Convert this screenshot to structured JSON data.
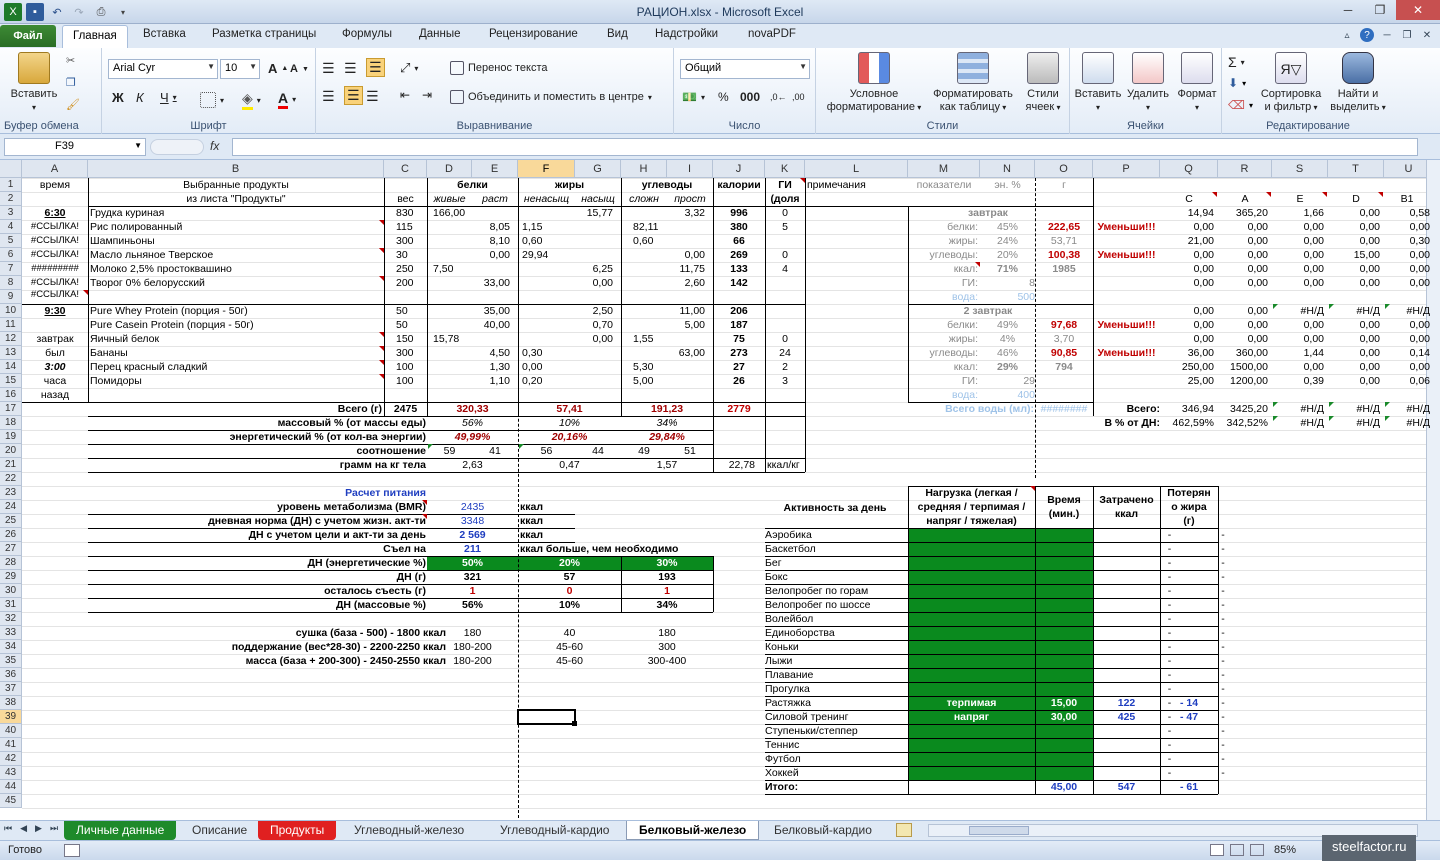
{
  "title": "РАЦИОН.xlsx - Microsoft Excel",
  "ribbon_tabs": [
    "Файл",
    "Главная",
    "Вставка",
    "Разметка страницы",
    "Формулы",
    "Данные",
    "Рецензирование",
    "Вид",
    "Надстройки",
    "novaPDF"
  ],
  "ribbon": {
    "paste": "Вставить",
    "clipboard": "Буфер обмена",
    "font_name": "Arial Cyr",
    "font_size": "10",
    "font_group": "Шрифт",
    "wrap": "Перенос текста",
    "merge": "Объединить и поместить в центре",
    "align_group": "Выравнивание",
    "num_format": "Общий",
    "number_group": "Число",
    "cond1": "Условное",
    "cond2": "форматирование",
    "fmt1": "Форматировать",
    "fmt2": "как таблицу",
    "sty1": "Стили",
    "sty2": "ячеек",
    "styles_group": "Стили",
    "ins": "Вставить",
    "del": "Удалить",
    "fmt": "Формат",
    "cells_group": "Ячейки",
    "sort1": "Сортировка",
    "sort2": "и фильтр",
    "find1": "Найти и",
    "find2": "выделить",
    "edit_group": "Редактирование"
  },
  "namebox": "F39",
  "fx": "fx",
  "columns": [
    "A",
    "B",
    "C",
    "D",
    "E",
    "F",
    "G",
    "H",
    "I",
    "J",
    "K",
    "L",
    "M",
    "N",
    "O",
    "P",
    "Q",
    "R",
    "S",
    "T",
    "U"
  ],
  "rows": [
    "1",
    "2",
    "3",
    "4",
    "5",
    "6",
    "7",
    "8",
    "9",
    "10",
    "11",
    "12",
    "13",
    "14",
    "15",
    "16",
    "17",
    "18",
    "19",
    "20",
    "21",
    "22",
    "23",
    "24",
    "25",
    "26",
    "27",
    "28",
    "29",
    "30",
    "31",
    "32",
    "33",
    "34",
    "35",
    "36",
    "37",
    "38",
    "39",
    "40",
    "41",
    "42",
    "43",
    "44",
    "45"
  ],
  "sheet_tabs": [
    "Личные данные",
    "Описание",
    "Продукты",
    "Углеводный-железо",
    "Углеводный-кардио",
    "Белковый-железо",
    "Белковый-кардио"
  ],
  "status": {
    "ready": "Готово",
    "zoom": "85%",
    "watermark": "steelfactor.ru"
  },
  "cells": {
    "h_time": "время",
    "h_prod1": "Выбранные продукты",
    "h_prod2": "из листа \"Продукты\"",
    "h_ves": "вес",
    "h_belki": "белки",
    "h_zhiry": "жиры",
    "h_ugl": "углеводы",
    "h_kal": "калории",
    "h_gi": "ГИ",
    "h_gi2": "(доля",
    "h_prim": "примечания",
    "h_pok": "показатели",
    "h_en": "эн. %",
    "h_g": "г",
    "h_zhiv": "живые",
    "h_rast": "раст",
    "h_nenas": "ненасыщ",
    "h_nas": "насыщ",
    "h_slozh": "сложн",
    "h_prost": "прост",
    "t630": "6:30",
    "t930": "9:30",
    "ref": "#ССЫЛКА!",
    "hash": "#########",
    "zav": "завтрак",
    "byl": "был",
    "t300": "3:00",
    "chasa": "часа",
    "nazad": "назад",
    "p1": "Грудка куриная",
    "p2": "Рис полированный",
    "p3": "Шампиньоны",
    "p4": "Масло льняное Тверское",
    "p5": "Молоко 2,5% простоквашино",
    "p6": "Творог 0% белорусский",
    "p7": "Pure Whey Protein (порция - 50г)",
    "p8": "Pure Casein Protein (порция - 50г)",
    "p9": "Яичный белок",
    "p10": "Бананы",
    "p11": "Перец красный сладкий",
    "p12": "Помидоры",
    "total": "Всего (г)",
    "mass": "массовый % (от массы еды)",
    "energy": "энергетический % (от кол-ва энергии)",
    "ratio": "соотношение",
    "gkg": "грамм на кг тела",
    "kkalkg": "ккал/кг",
    "calc": "Расчет питания",
    "bmr": "уровень метаболизма (BMR)",
    "dn": "дневная норма (ДН) с учетом жизн. акт-ти",
    "dn2": "ДН с учетом цели и акт-ти за день",
    "ate": "Съел на",
    "dnen": "ДН (энергетические %)",
    "dng": "ДН (г)",
    "left": "осталось съесть (г)",
    "dnm": "ДН (массовые %)",
    "kkal": "ккал",
    "more": "ккал больше, чем необходимо",
    "s1": "сушка (база - 500) - 1800 ккал",
    "s2": "поддержание (вес*28-30) - 2200-2250 ккал",
    "s3": "масса (база + 200-300) - 2450-2550 ккал",
    "zav1": "завтрак",
    "zav2": "2 завтрак",
    "lb": "белки:",
    "lz": "жиры:",
    "lu": "углеводы:",
    "lk": "ккал:",
    "lgi": "ГИ:",
    "lvoda": "вода:",
    "vsvoda": "Всего воды (мл):",
    "umen": "Уменьши!!!",
    "vsego": "Всего:",
    "vdn": "В % от ДН:",
    "na": "#Н/Д",
    "act": "Активность за день",
    "nagr1": "Нагрузка (легкая /",
    "nagr2": "средняя / терпимая /",
    "nagr3": "напряг / тяжелая)",
    "vr1": "Время",
    "vr2": "(мин.)",
    "zk1": "Затрачено",
    "zk2": "ккал",
    "pot1": "Потерян",
    "pot2": "о жира",
    "pot3": "(г)",
    "acts": [
      "Аэробика",
      "Баскетбол",
      "Бег",
      "Бокс",
      "Велопробег по горам",
      "Велопробег по шоссе",
      "Волейбол",
      "Единоборства",
      "Коньки",
      "Лыжи",
      "Плавание",
      "Прогулка",
      "Растяжка",
      "Силовой тренинг",
      "Ступеньки/степпер",
      "Теннис",
      "Футбол",
      "Хоккей",
      "Итого:"
    ],
    "terp": "терпимая",
    "napr": "напряг",
    "colhdr_q": "C",
    "colhdr_r": "A",
    "colhdr_s": "E",
    "colhdr_t": "D",
    "colhdr_u": "B1"
  }
}
